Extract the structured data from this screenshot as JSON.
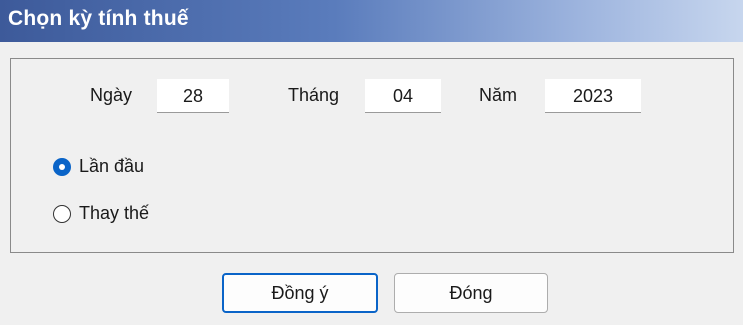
{
  "window": {
    "title": "Chọn kỳ tính thuế"
  },
  "date": {
    "day_label": "Ngày",
    "day_value": "28",
    "month_label": "Tháng",
    "month_value": "04",
    "year_label": "Năm",
    "year_value": "2023"
  },
  "options": [
    {
      "label": "Lần đầu",
      "selected": true
    },
    {
      "label": "Thay thế",
      "selected": false
    }
  ],
  "buttons": {
    "ok_label": "Đồng ý",
    "close_label": "Đóng"
  },
  "colors": {
    "accent": "#0a64c8",
    "titlebar_start": "#3d5a9a",
    "titlebar_end": "#c7d6ee"
  }
}
